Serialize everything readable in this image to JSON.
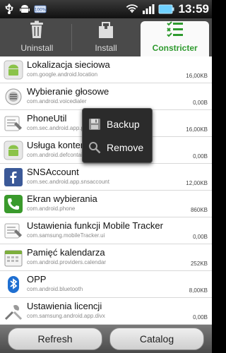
{
  "status_bar": {
    "time": "13:59",
    "icons": [
      "usb-icon",
      "android-icon",
      "mobile-tracker-icon",
      "wifi-icon",
      "signal-icon",
      "battery-icon"
    ]
  },
  "tabs": [
    {
      "label": "Uninstall",
      "icon": "trash-icon",
      "active": false
    },
    {
      "label": "Install",
      "icon": "package-icon",
      "active": false
    },
    {
      "label": "Constricter",
      "icon": "checklist-icon",
      "active": true
    }
  ],
  "apps": [
    {
      "name": "Lokalizacja sieciowa",
      "package": "com.google.android.location",
      "size": "16,00KB",
      "icon": "android-icon"
    },
    {
      "name": "Wybieranie głosowe",
      "package": "com.android.voicedialer",
      "size": "0,00B",
      "icon": "voice-dialer-icon"
    },
    {
      "name": "PhoneUtil",
      "package": "com.sec.android.app.p",
      "size": "16,00KB",
      "icon": "settings-icon"
    },
    {
      "name": "Usługa kontenera",
      "package": "com.android.defcontai",
      "size": "0,00B",
      "icon": "android-icon"
    },
    {
      "name": "SNSAccount",
      "package": "com.sec.android.app.snsaccount",
      "size": "12,00KB",
      "icon": "facebook-icon"
    },
    {
      "name": "Ekran wybierania",
      "package": "com.android.phone",
      "size": "860KB",
      "icon": "phone-icon"
    },
    {
      "name": "Ustawienia funkcji Mobile Tracker",
      "package": "com.samsung.mobileTracker.ui",
      "size": "0,00B",
      "icon": "settings-icon"
    },
    {
      "name": "Pamięć kalendarza",
      "package": "com.android.providers.calendar",
      "size": "252KB",
      "icon": "calendar-icon"
    },
    {
      "name": "OPP",
      "package": "com.android.bluetooth",
      "size": "8,00KB",
      "icon": "bluetooth-icon"
    },
    {
      "name": "Ustawienia licencji",
      "package": "com.samsung.android.app.divx",
      "size": "0,00B",
      "icon": "tools-icon"
    }
  ],
  "popup_menu": {
    "items": [
      {
        "label": "Backup",
        "icon": "save-icon"
      },
      {
        "label": "Remove",
        "icon": "remove-icon"
      }
    ]
  },
  "bottom_buttons": {
    "refresh_label": "Refresh",
    "catalog_label": "Catalog"
  },
  "colors": {
    "accent_green": "#2e9a2e",
    "android_green": "#8bc34a",
    "facebook_blue": "#3b5998"
  }
}
